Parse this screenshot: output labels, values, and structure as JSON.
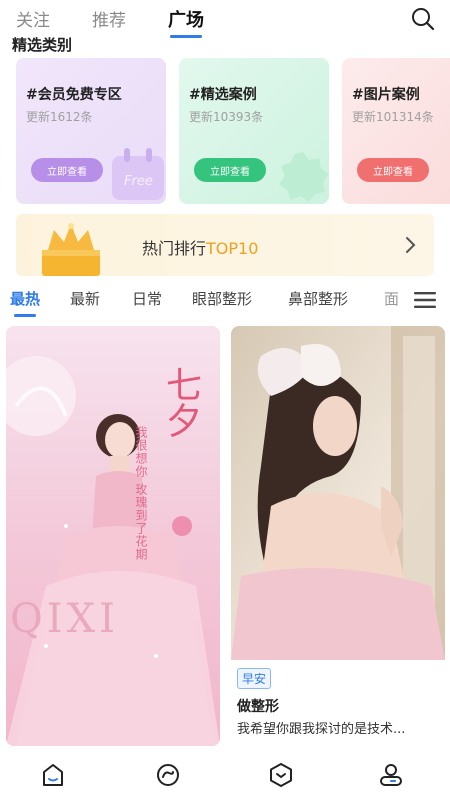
{
  "topnav": {
    "tabs": [
      {
        "label": "关注"
      },
      {
        "label": "推荐"
      },
      {
        "label": "广场"
      }
    ],
    "active_tab": "广场",
    "accent_color": "#2f7bea"
  },
  "section": {
    "title": "精选类别"
  },
  "cards": [
    {
      "title": "#会员免费专区",
      "subtitle": "更新1612条",
      "button": "立即查看",
      "deco_text": "Free",
      "color": "#b88fe8"
    },
    {
      "title": "#精选案例",
      "subtitle": "更新10393条",
      "button": "立即查看",
      "color": "#35c47e"
    },
    {
      "title": "#图片案例",
      "subtitle": "更新101314条",
      "button": "立即查看",
      "color": "#f07070"
    }
  ],
  "banner": {
    "text": "热门排行",
    "accent": "TOP10",
    "icon": "crown-icon"
  },
  "feed_tabs": [
    {
      "label": "最热"
    },
    {
      "label": "最新"
    },
    {
      "label": "日常"
    },
    {
      "label": "眼部整形"
    },
    {
      "label": "鼻部整形"
    },
    {
      "label": "面"
    }
  ],
  "posts": {
    "left": {
      "heading": "七夕",
      "subheading": "我很想你 玫瑰到了花期",
      "english": "QIXI"
    },
    "right": {
      "badge": "早安",
      "title": "做整形",
      "desc": "我希望你跟我探讨的是技术..."
    }
  },
  "bottom_nav": [
    {
      "icon": "home-icon"
    },
    {
      "icon": "discover-icon"
    },
    {
      "icon": "cube-icon"
    },
    {
      "icon": "profile-icon"
    }
  ]
}
